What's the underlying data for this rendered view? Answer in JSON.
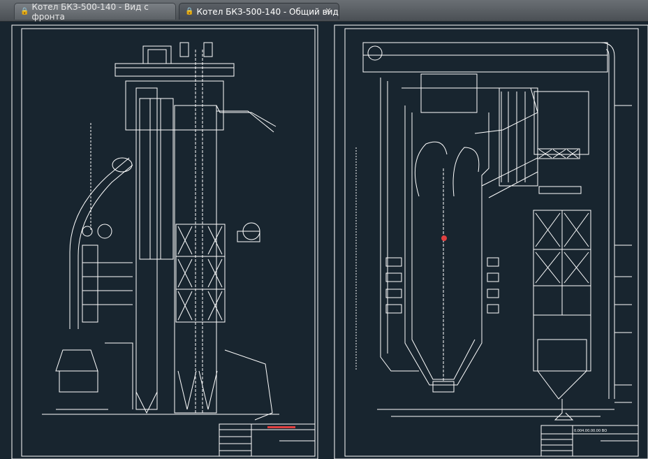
{
  "tabs": [
    {
      "label": "Котел БКЗ-500-140 - Вид с фронта",
      "lock_icon": "lock-icon"
    },
    {
      "label": "Котел БКЗ-500-140 - Общий вид",
      "lock_icon": "lock-icon",
      "close_icon": "close-icon"
    }
  ],
  "drawings": {
    "left_title": "",
    "right_stamp_code": "0.004.00.00.00 ВО"
  },
  "colors": {
    "background": "#18252f",
    "lines": "#ffffff",
    "accent_red": "#e04040"
  }
}
